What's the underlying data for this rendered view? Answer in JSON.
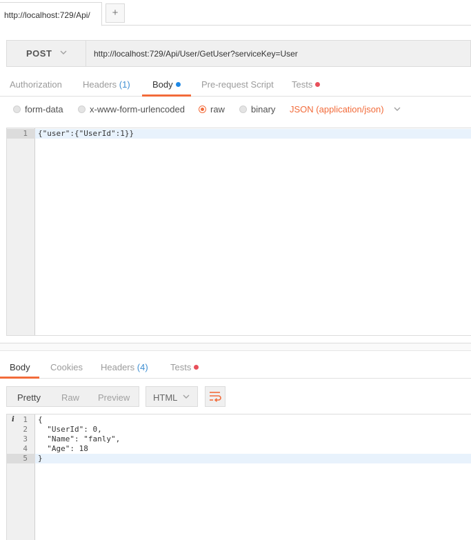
{
  "tabs": {
    "request_tab_title": "http://localhost:729/Api/",
    "add_tab": "+"
  },
  "request": {
    "method": "POST",
    "url": "http://localhost:729/Api/User/GetUser?serviceKey=User"
  },
  "request_tabs": {
    "authorization": "Authorization",
    "headers": "Headers",
    "headers_count": "(1)",
    "body": "Body",
    "prerequest": "Pre-request Script",
    "tests": "Tests"
  },
  "body_types": {
    "form_data": "form-data",
    "urlencoded": "x-www-form-urlencoded",
    "raw": "raw",
    "binary": "binary",
    "selected": "raw",
    "content_type": "JSON (application/json)"
  },
  "request_body": {
    "line_numbers": [
      "1"
    ],
    "lines": [
      "{\"user\":{\"UserId\":1}}"
    ]
  },
  "response_tabs": {
    "body": "Body",
    "cookies": "Cookies",
    "headers": "Headers",
    "headers_count": "(4)",
    "tests": "Tests"
  },
  "response_toolbar": {
    "pretty": "Pretty",
    "raw": "Raw",
    "preview": "Preview",
    "format": "HTML"
  },
  "response_body": {
    "info_marker": "i",
    "line_numbers": [
      "1",
      "2",
      "3",
      "4",
      "5"
    ],
    "lines": [
      "{",
      "  \"UserId\": 0,",
      "  \"Name\": \"fanly\",",
      "  \"Age\": 18",
      "}"
    ]
  },
  "colors": {
    "accent": "#f26b3a",
    "link_blue": "#3f8fd2",
    "body_dot": "#1e88e5",
    "tests_dot": "#e8505b"
  },
  "icons": {
    "method_dropdown": "chevron-down-icon",
    "content_type_dropdown": "chevron-down-icon",
    "wrap": "wrap-lines-icon",
    "info": "info-icon"
  }
}
